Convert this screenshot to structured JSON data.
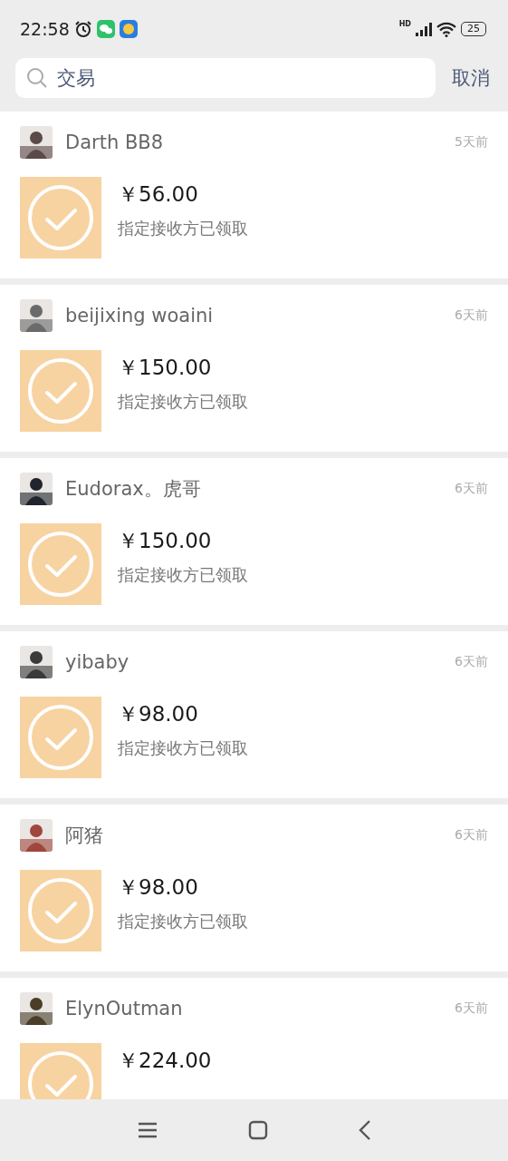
{
  "status_bar": {
    "time": "22:58",
    "network_label": "HD",
    "battery": "25"
  },
  "search": {
    "value": "交易",
    "cancel": "取消"
  },
  "transactions": [
    {
      "name": "Darth BB8",
      "time": "5天前",
      "amount": "￥56.00",
      "status": "指定接收方已领取"
    },
    {
      "name": "beijixing woaini",
      "time": "6天前",
      "amount": "￥150.00",
      "status": "指定接收方已领取"
    },
    {
      "name": "Eudorax。虎哥",
      "time": "6天前",
      "amount": "￥150.00",
      "status": "指定接收方已领取"
    },
    {
      "name": "yibaby",
      "time": "6天前",
      "amount": "￥98.00",
      "status": "指定接收方已领取"
    },
    {
      "name": "阿猪",
      "time": "6天前",
      "amount": "￥98.00",
      "status": "指定接收方已领取"
    },
    {
      "name": "ElynOutman",
      "time": "6天前",
      "amount": "￥224.00"
    }
  ]
}
